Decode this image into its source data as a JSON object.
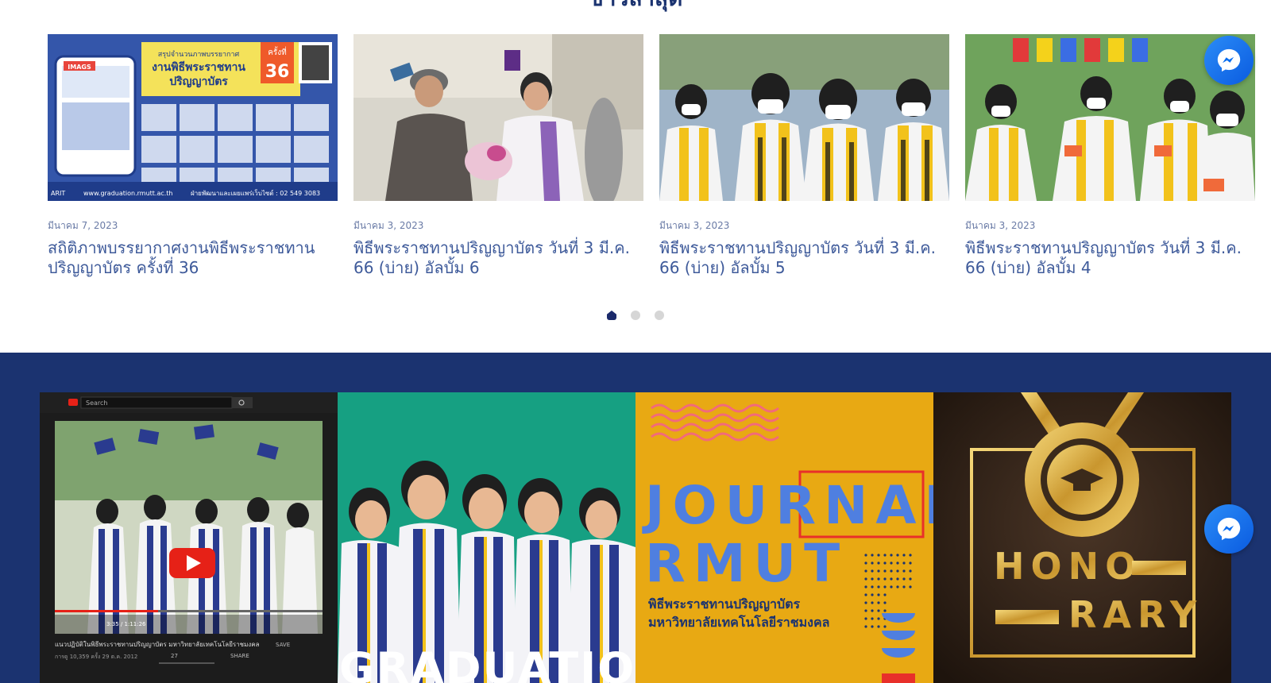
{
  "news_section": {
    "heading": "ข่าวล่าสุด",
    "cards": [
      {
        "date": "มีนาคม 7, 2023",
        "title": "สถิติภาพบรรยากาศงานพิธีพระราชทานปริญญาบัตร ครั้งที่ 36"
      },
      {
        "date": "มีนาคม 3, 2023",
        "title": "พิธีพระราชทานปริญญาบัตร วันที่ 3 มี.ค. 66 (บ่าย) อัลบั้ม 6"
      },
      {
        "date": "มีนาคม 3, 2023",
        "title": "พิธีพระราชทานปริญญาบัตร วันที่ 3 มี.ค. 66 (บ่าย) อัลบั้ม 5"
      },
      {
        "date": "มีนาคม 3, 2023",
        "title": "พิธีพระราชทานปริญญาบัตร วันที่ 3 มี.ค. 66 (บ่าย) อัลบั้ม 4"
      }
    ],
    "poster": {
      "banner_line1": "สรุปจำนวนภาพบรรยากาศ",
      "banner_line2": "งานพิธีพระราชทาน",
      "banner_line3": "ปริญญาบัตร",
      "badge_top": "ครั้งที่",
      "badge_num": "36",
      "brand": "IMAGS",
      "footer_url": "www.graduation.rmutt.ac.th",
      "footer_contact": "ฝ่ายพัฒนาและเผยแพร่เว็บไซต์ : 02 549 3083",
      "side_label": "ARIT"
    },
    "dots": {
      "count": 3,
      "active_index": 0
    }
  },
  "gallery": {
    "video": {
      "search_placeholder": "Search",
      "time": "3:35 / 1:11:26",
      "caption": "แนวปฏิบัติในพิธีพระราชทานปริญญาบัตร มหาวิทยาลัยเทคโนโลยีราชมงคล",
      "meta": "การดู 10,359 ครั้ง 29 ต.ค. 2012",
      "likes": "27",
      "share": "SHARE",
      "save": "SAVE"
    },
    "graduation_text": "GRADUATION",
    "journal": {
      "line1": "JOURNAL",
      "line2": "RMUT",
      "sub1": "พิธีพระราชทานปริญญาบัตร",
      "sub2": "มหาวิทยาลัยเทคโนโลยีราชมงคล"
    },
    "honorary": {
      "line1": "HONO",
      "line2": "RARY"
    }
  },
  "colors": {
    "brand_navy": "#1b3370",
    "title_blue": "#3e5a9a",
    "messenger_blue": "#0a7cff"
  },
  "icons": [
    "messenger-icon",
    "play-icon",
    "search-icon"
  ]
}
